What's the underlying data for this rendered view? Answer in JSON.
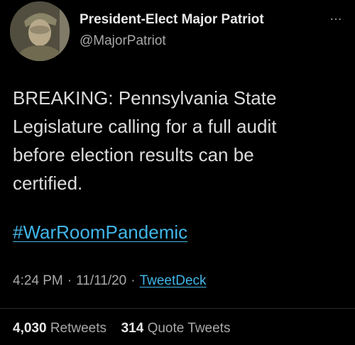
{
  "profile": {
    "display_name": "President-Elect Major Patriot",
    "handle": "@MajorPatriot",
    "avatar_icon": "soldier-portrait-avatar"
  },
  "more_icon": "…",
  "tweet": {
    "lines": [
      "BREAKING:  Pennsylvania State",
      "Legislature calling for a full audit",
      "before election results can be",
      "certified."
    ],
    "hashtag": "#WarRoomPandemic"
  },
  "meta": {
    "time": "4:24 PM",
    "separator": "·",
    "date": "11/11/20",
    "source": "TweetDeck"
  },
  "stats": {
    "retweets_count": "4,030",
    "retweets_label": "Retweets",
    "quotes_count": "314",
    "quotes_label": "Quote Tweets"
  },
  "colors": {
    "background": "#000000",
    "text": "#dcdcdc",
    "muted": "#a8a8a8",
    "link": "#41b6e8"
  }
}
